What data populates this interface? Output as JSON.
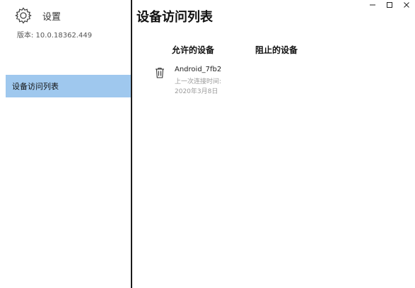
{
  "app": {
    "title": "设置",
    "version": "版本: 10.0.18362.449"
  },
  "sidebar": {
    "items": [
      {
        "label": "设备访问列表",
        "selected": true
      }
    ]
  },
  "window_controls": {
    "minimize": "—",
    "maximize": "☐",
    "close": "✕"
  },
  "main": {
    "title": "设备访问列表",
    "tabs": [
      {
        "label": "允许的设备"
      },
      {
        "label": "阻止的设备"
      }
    ],
    "devices": [
      {
        "name": "Android_7fb2",
        "last_connected_label": "上一次连接时间:",
        "last_connected_date": "2020年3月8日",
        "icon": "trash-icon"
      }
    ]
  },
  "colors": {
    "selected_nav": "#9fc8ee",
    "divider": "#1a1a1a",
    "muted_text": "#9a9a9a"
  }
}
